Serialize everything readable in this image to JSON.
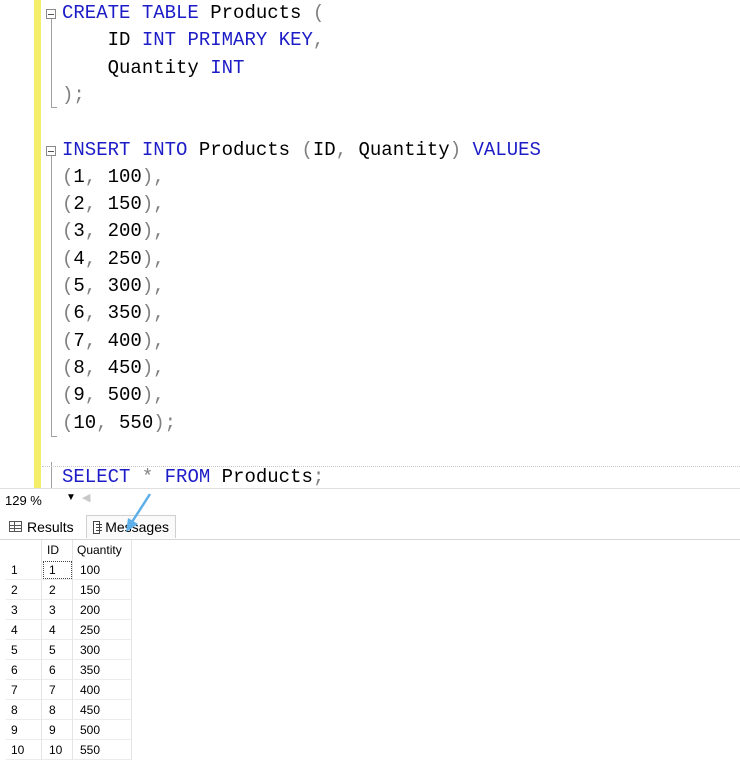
{
  "editor": {
    "lines": [
      {
        "tokens": [
          {
            "t": "CREATE",
            "c": "kw"
          },
          {
            "t": " "
          },
          {
            "t": "TABLE",
            "c": "kw"
          },
          {
            "t": " Products "
          },
          {
            "t": "(",
            "c": "punc"
          }
        ]
      },
      {
        "tokens": [
          {
            "t": "    ID "
          },
          {
            "t": "INT",
            "c": "kw"
          },
          {
            "t": " "
          },
          {
            "t": "PRIMARY",
            "c": "kw"
          },
          {
            "t": " "
          },
          {
            "t": "KEY",
            "c": "kw"
          },
          {
            "t": ",",
            "c": "punc"
          }
        ]
      },
      {
        "tokens": [
          {
            "t": "    Quantity "
          },
          {
            "t": "INT",
            "c": "kw"
          }
        ]
      },
      {
        "tokens": [
          {
            "t": ");",
            "c": "punc"
          }
        ]
      },
      {
        "tokens": []
      },
      {
        "tokens": [
          {
            "t": "INSERT",
            "c": "kw"
          },
          {
            "t": " "
          },
          {
            "t": "INTO",
            "c": "kw"
          },
          {
            "t": " Products "
          },
          {
            "t": "(",
            "c": "punc"
          },
          {
            "t": "ID"
          },
          {
            "t": ",",
            "c": "punc"
          },
          {
            "t": " Quantity"
          },
          {
            "t": ")",
            "c": "punc"
          },
          {
            "t": " "
          },
          {
            "t": "VALUES",
            "c": "kw"
          }
        ]
      },
      {
        "tokens": [
          {
            "t": "(",
            "c": "punc"
          },
          {
            "t": "1"
          },
          {
            "t": ",",
            "c": "punc"
          },
          {
            "t": " 100"
          },
          {
            "t": "),",
            "c": "punc"
          }
        ]
      },
      {
        "tokens": [
          {
            "t": "(",
            "c": "punc"
          },
          {
            "t": "2"
          },
          {
            "t": ",",
            "c": "punc"
          },
          {
            "t": " 150"
          },
          {
            "t": "),",
            "c": "punc"
          }
        ]
      },
      {
        "tokens": [
          {
            "t": "(",
            "c": "punc"
          },
          {
            "t": "3"
          },
          {
            "t": ",",
            "c": "punc"
          },
          {
            "t": " 200"
          },
          {
            "t": "),",
            "c": "punc"
          }
        ]
      },
      {
        "tokens": [
          {
            "t": "(",
            "c": "punc"
          },
          {
            "t": "4"
          },
          {
            "t": ",",
            "c": "punc"
          },
          {
            "t": " 250"
          },
          {
            "t": "),",
            "c": "punc"
          }
        ]
      },
      {
        "tokens": [
          {
            "t": "(",
            "c": "punc"
          },
          {
            "t": "5"
          },
          {
            "t": ",",
            "c": "punc"
          },
          {
            "t": " 300"
          },
          {
            "t": "),",
            "c": "punc"
          }
        ]
      },
      {
        "tokens": [
          {
            "t": "(",
            "c": "punc"
          },
          {
            "t": "6"
          },
          {
            "t": ",",
            "c": "punc"
          },
          {
            "t": " 350"
          },
          {
            "t": "),",
            "c": "punc"
          }
        ]
      },
      {
        "tokens": [
          {
            "t": "(",
            "c": "punc"
          },
          {
            "t": "7"
          },
          {
            "t": ",",
            "c": "punc"
          },
          {
            "t": " 400"
          },
          {
            "t": "),",
            "c": "punc"
          }
        ]
      },
      {
        "tokens": [
          {
            "t": "(",
            "c": "punc"
          },
          {
            "t": "8"
          },
          {
            "t": ",",
            "c": "punc"
          },
          {
            "t": " 450"
          },
          {
            "t": "),",
            "c": "punc"
          }
        ]
      },
      {
        "tokens": [
          {
            "t": "(",
            "c": "punc"
          },
          {
            "t": "9"
          },
          {
            "t": ",",
            "c": "punc"
          },
          {
            "t": " 500"
          },
          {
            "t": "),",
            "c": "punc"
          }
        ]
      },
      {
        "tokens": [
          {
            "t": "(",
            "c": "punc"
          },
          {
            "t": "10"
          },
          {
            "t": ",",
            "c": "punc"
          },
          {
            "t": " 550"
          },
          {
            "t": ");",
            "c": "punc"
          }
        ]
      },
      {
        "tokens": []
      },
      {
        "tokens": [
          {
            "t": "SELECT",
            "c": "kw"
          },
          {
            "t": " "
          },
          {
            "t": "*",
            "c": "punc"
          },
          {
            "t": " "
          },
          {
            "t": "FROM",
            "c": "kw"
          },
          {
            "t": " Products"
          },
          {
            "t": ";",
            "c": "punc"
          }
        ]
      }
    ]
  },
  "status": {
    "zoom": "129 %"
  },
  "tabs": {
    "results": "Results",
    "messages": "Messages"
  },
  "grid": {
    "headers": [
      "ID",
      "Quantity"
    ],
    "rows": [
      [
        "1",
        "1",
        "100"
      ],
      [
        "2",
        "2",
        "150"
      ],
      [
        "3",
        "3",
        "200"
      ],
      [
        "4",
        "4",
        "250"
      ],
      [
        "5",
        "5",
        "300"
      ],
      [
        "6",
        "6",
        "350"
      ],
      [
        "7",
        "7",
        "400"
      ],
      [
        "8",
        "8",
        "450"
      ],
      [
        "9",
        "9",
        "500"
      ],
      [
        "10",
        "10",
        "550"
      ]
    ]
  },
  "colors": {
    "keyword": "#1d1dc8",
    "punctuation": "#808080",
    "change_bar": "#f5ee6a"
  }
}
